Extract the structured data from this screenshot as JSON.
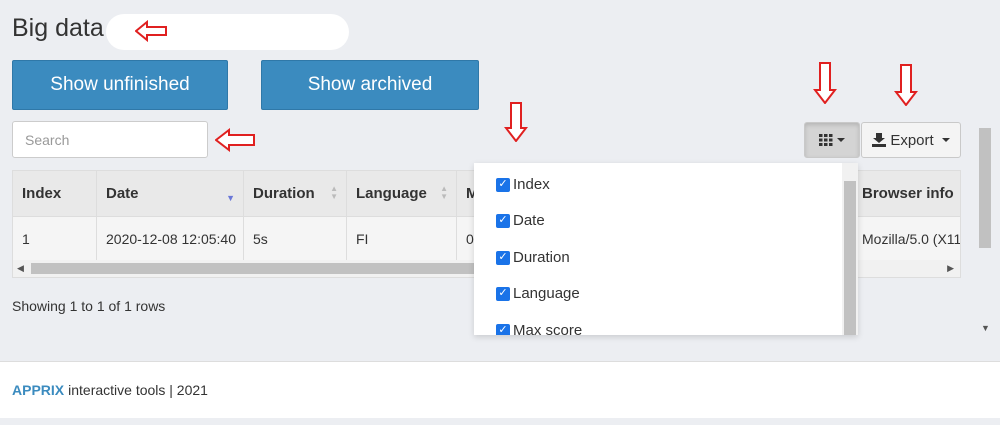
{
  "header": {
    "title": "Big data"
  },
  "buttons": {
    "show_unfinished": "Show unfinished",
    "show_archived": "Show archived"
  },
  "search": {
    "placeholder": "Search"
  },
  "toolbar": {
    "columns_icon": "grid-icon",
    "export_label": "Export",
    "export_icon": "download-icon"
  },
  "table": {
    "columns": [
      "Index",
      "Date",
      "Duration",
      "Language",
      "M",
      "Browser info"
    ],
    "sorted_column": "Date",
    "rows": [
      [
        "1",
        "2020-12-08 12:05:40",
        "5s",
        "FI",
        "0",
        "Mozilla/5.0 (X11"
      ]
    ]
  },
  "columns_dropdown": {
    "items": [
      {
        "label": "Index",
        "checked": true
      },
      {
        "label": "Date",
        "checked": true
      },
      {
        "label": "Duration",
        "checked": true
      },
      {
        "label": "Language",
        "checked": true
      },
      {
        "label": "Max score",
        "checked": true
      }
    ]
  },
  "pagination": {
    "summary": "Showing 1 to 1 of 1 rows"
  },
  "footer": {
    "brand": "APPRIX",
    "text": "interactive tools | 2021"
  },
  "colors": {
    "primary": "#3b8bbf",
    "annotation_arrow": "#e02020",
    "checkbox": "#1a73e8",
    "sort_active": "#6b78d8"
  }
}
